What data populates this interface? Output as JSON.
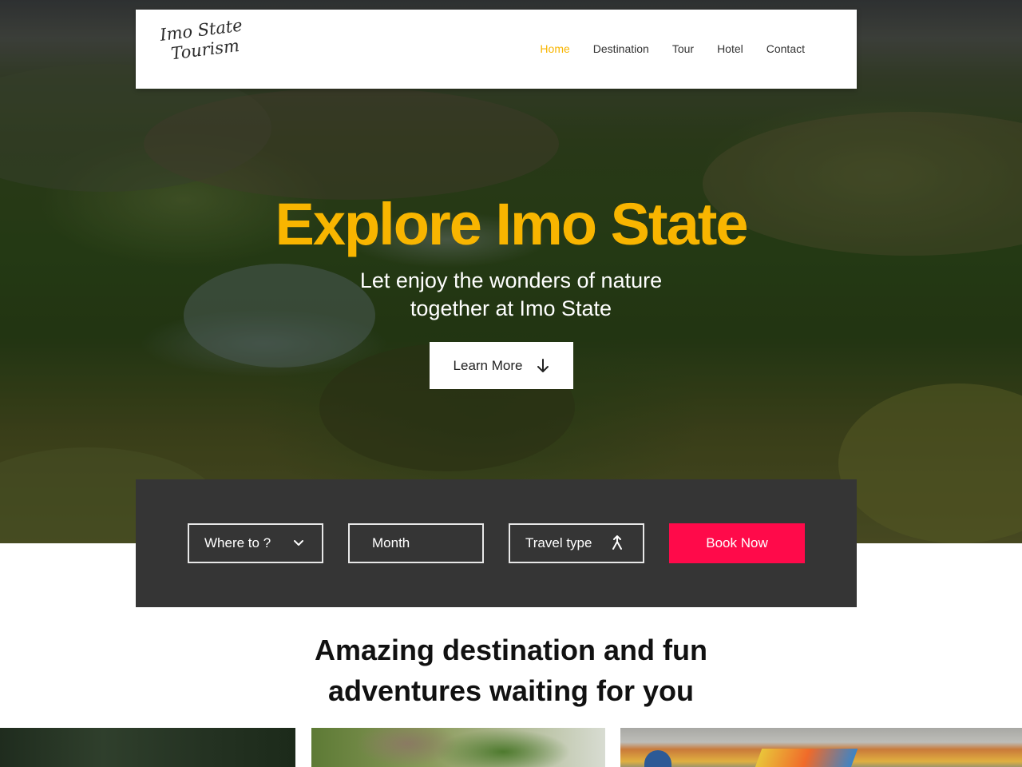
{
  "brand": {
    "line1": "Imo State",
    "line2": "Tourism"
  },
  "nav": {
    "items": [
      {
        "label": "Home",
        "active": true
      },
      {
        "label": "Destination",
        "active": false
      },
      {
        "label": "Tour",
        "active": false
      },
      {
        "label": "Hotel",
        "active": false
      },
      {
        "label": "Contact",
        "active": false
      }
    ]
  },
  "hero": {
    "title": "Explore Imo State",
    "subtitle_line1": "Let enjoy the wonders of nature",
    "subtitle_line2": "together at Imo State",
    "cta_label": "Learn More",
    "cta_icon": "arrow-down-icon"
  },
  "booking": {
    "where_label": "Where to ?",
    "where_icon": "chevron-down-icon",
    "month_label": "Month",
    "travel_type_label": "Travel type",
    "travel_type_icon": "merge-arrows-icon",
    "book_label": "Book Now"
  },
  "section": {
    "headline_bold1": "Amazing",
    "headline_regular1": "destination and fun",
    "headline_regular2": "adventures",
    "headline_bold2": "waiting for you"
  },
  "colors": {
    "accent": "#f8b500",
    "book_button": "#ff0a4a",
    "booking_panel": "#353535",
    "text_dark": "#333333"
  }
}
